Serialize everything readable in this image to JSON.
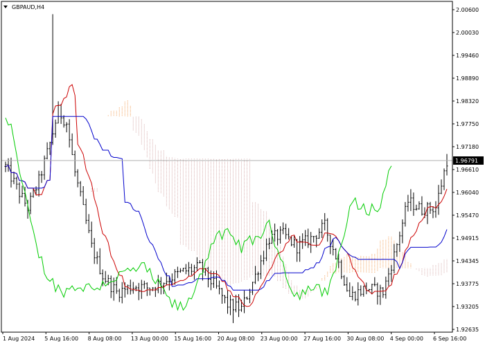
{
  "window": {
    "title": "GBPAUD,H4"
  },
  "colors": {
    "background": "#ffffff",
    "bar": "#000000",
    "tenkan": "#cc0000",
    "kijun": "#0000cc",
    "chikou": "#00cc00",
    "cloud_bullish": "#f4a460",
    "cloud_bearish": "#d8b0b0",
    "price_line": "#b0b0b0",
    "price_tag_bg": "#000000",
    "price_tag_text": "#ffffff"
  },
  "chart_data": {
    "type": "candlestick",
    "symbol": "GBPAUD",
    "timeframe": "H4",
    "indicators": [
      "Ichimoku Kinko Hyo"
    ],
    "y_axis": {
      "range": [
        1.9263,
        2.0065
      ],
      "ticks": [
        "2.00600",
        "2.00030",
        "1.99460",
        "1.98890",
        "1.98320",
        "1.97750",
        "1.97180",
        "1.96610",
        "1.96040",
        "1.95470",
        "1.94915",
        "1.94345",
        "1.93775",
        "1.93205",
        "1.92635"
      ]
    },
    "x_axis": {
      "ticks": [
        "1 Aug 2024",
        "5 Aug 16:00",
        "8 Aug 08:00",
        "13 Aug 00:00",
        "15 Aug 16:00",
        "20 Aug 08:00",
        "23 Aug 00:00",
        "27 Aug 16:00",
        "30 Aug 08:00",
        "4 Sep 00:00",
        "6 Sep 16:00"
      ]
    },
    "current_price": "1.96791",
    "current_price_value": 1.96791,
    "grid": false
  }
}
